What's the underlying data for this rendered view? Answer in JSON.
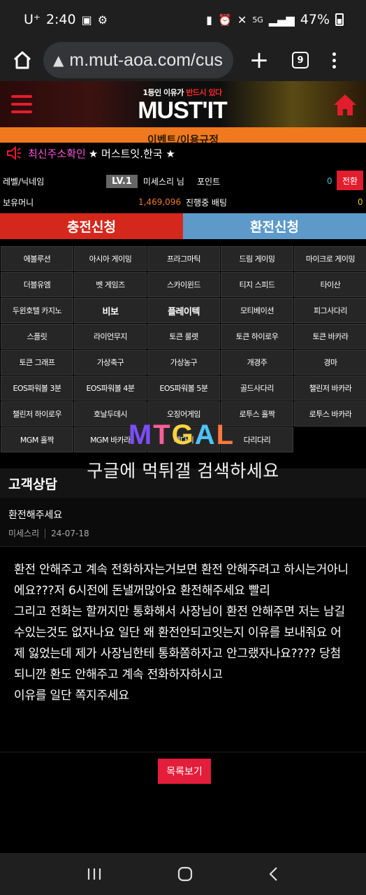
{
  "status_bar": {
    "carrier": "U⁺",
    "time": "2:40",
    "network": "5G",
    "battery": "47%"
  },
  "browser": {
    "url": "m.mut-aoa.com/cus",
    "tab_count": "9"
  },
  "header": {
    "tagline_prefix": "1등인 이유가 ",
    "tagline_highlight": "반드시 있다",
    "logo": "MUST'IT"
  },
  "event_banner": "이벤트/이용규정",
  "notice": {
    "pink": "최신주소확인",
    "white": "★ 머스트잇.한국 ★"
  },
  "user_info": {
    "level_label": "레벨/닉네임",
    "level": "LV.1",
    "nickname": "미세스리 님",
    "points_label": "포인트",
    "points": "0",
    "swap_button": "전환",
    "money_label": "보유머니",
    "money": "1,469,096",
    "pending_label": "진행중 배팅",
    "pending": "0"
  },
  "actions": {
    "deposit": "충전신청",
    "withdraw": "환전신청"
  },
  "games": [
    "에볼루션",
    "아시아 게이밍",
    "프라그마틱",
    "드림 게이밍",
    "마이크로 게이밍",
    "더블유엠",
    "벳 게임즈",
    "스카이윈드",
    "티지 스피드",
    "타이산",
    "두윈호텔 카지노",
    "비보",
    "플레이텍",
    "모티베이션",
    "피그사다리",
    "스플릿",
    "라이언무지",
    "토큰 룰렛",
    "토큰 하이로우",
    "토큰 바카라",
    "토큰 그래프",
    "가상축구",
    "가상농구",
    "개경주",
    "경마",
    "EOS파워볼 3분",
    "EOS파워볼 4분",
    "EOS파워볼 5분",
    "골드사다리",
    "챌린저 바카라",
    "챌린저 하이로우",
    "호날두데시",
    "오징어게임",
    "로투스 홀짝",
    "로투스 바카라",
    "MGM 홀짝",
    "MGM 바카라",
    "세다리",
    "다리다리"
  ],
  "watermark": {
    "logo": "MTGAL",
    "text": "구글에 먹튀갤 검색하세요"
  },
  "support": {
    "section_title": "고객상담",
    "post_title": "환전해주세요",
    "author": "미세스리",
    "date": "24-07-18",
    "body_lines": [
      "환전 안해주고 계속 전화하자는거보면 환전 안해주려고 하시는거아니에요???저 6시전에 돈낼꺼많아요 환전해주세요 빨리",
      "그리고 전화는 할꺼지만 통화해서 사장님이 환전 안해주면 저는 남길수있는것도 없자나요 일단 왜 환전안되고잇는지 이유를 보내줘요 어제 잃었는데 제가 사장님한테 통화쫌하자고 안그랬자나요???? 당첨 되니깐 환도 안해주고 계속 전화하자하시고",
      "이유를 일단 쪽지주세요"
    ],
    "list_button": "목록보기"
  }
}
